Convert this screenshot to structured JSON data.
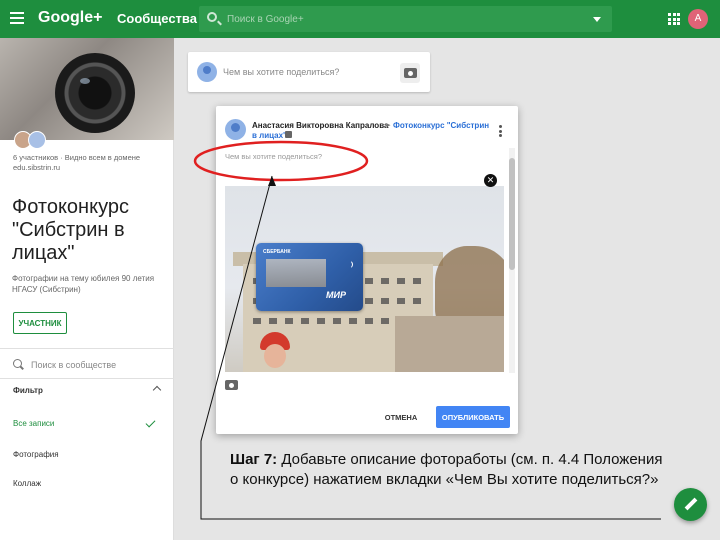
{
  "app": {
    "logo": "Google+",
    "section": "Сообщества",
    "search_placeholder": "Поиск в Google+",
    "user_initial": "А",
    "brand_color": "#1e8e3e"
  },
  "community": {
    "members_info": "6 участников · Видно всем в домене edu.sibstrin.ru",
    "title": "Фотоконкурс \"Сибстрин в лицах\"",
    "description": "Фотографии на тему юбилея 90 летия НГАСУ (Сибстрин)",
    "member_button": "УЧАСТНИК",
    "search_placeholder": "Поиск в сообществе",
    "filter_label": "Фильтр",
    "filter_items": [
      "Все записи",
      "Фотография",
      "Коллаж"
    ]
  },
  "feed": {
    "share_placeholder": "Чем вы хотите поделиться?"
  },
  "dialog": {
    "author": "Анастасия Викторовна Капралова",
    "arrow": "▸",
    "target_line1": "Фотоконкурс \"Сибстрин",
    "target_line2": "в лицах\"",
    "input_placeholder": "Чем вы хотите поделиться?",
    "card_brand": "СБЕРБАНК",
    "card_network": "МИР",
    "cancel_label": "ОТМЕНА",
    "publish_label": "ОПУБЛИКОВАТЬ",
    "close_symbol": "✕",
    "publish_color": "#4285f4"
  },
  "annotation": {
    "step_label": "Шаг 7:",
    "instruction": " Добавьте описание фотоработы (см. п. 4.4 Положения о конкурсе) нажатием вкладки «Чем Вы хотите поделиться?»",
    "highlight_color": "#e02020"
  },
  "icons": [
    "menu-icon",
    "search-icon",
    "apps-icon",
    "camera-icon",
    "lock-icon",
    "more-vert-icon",
    "close-icon",
    "check-icon",
    "chevron-up-icon",
    "pencil-icon"
  ]
}
